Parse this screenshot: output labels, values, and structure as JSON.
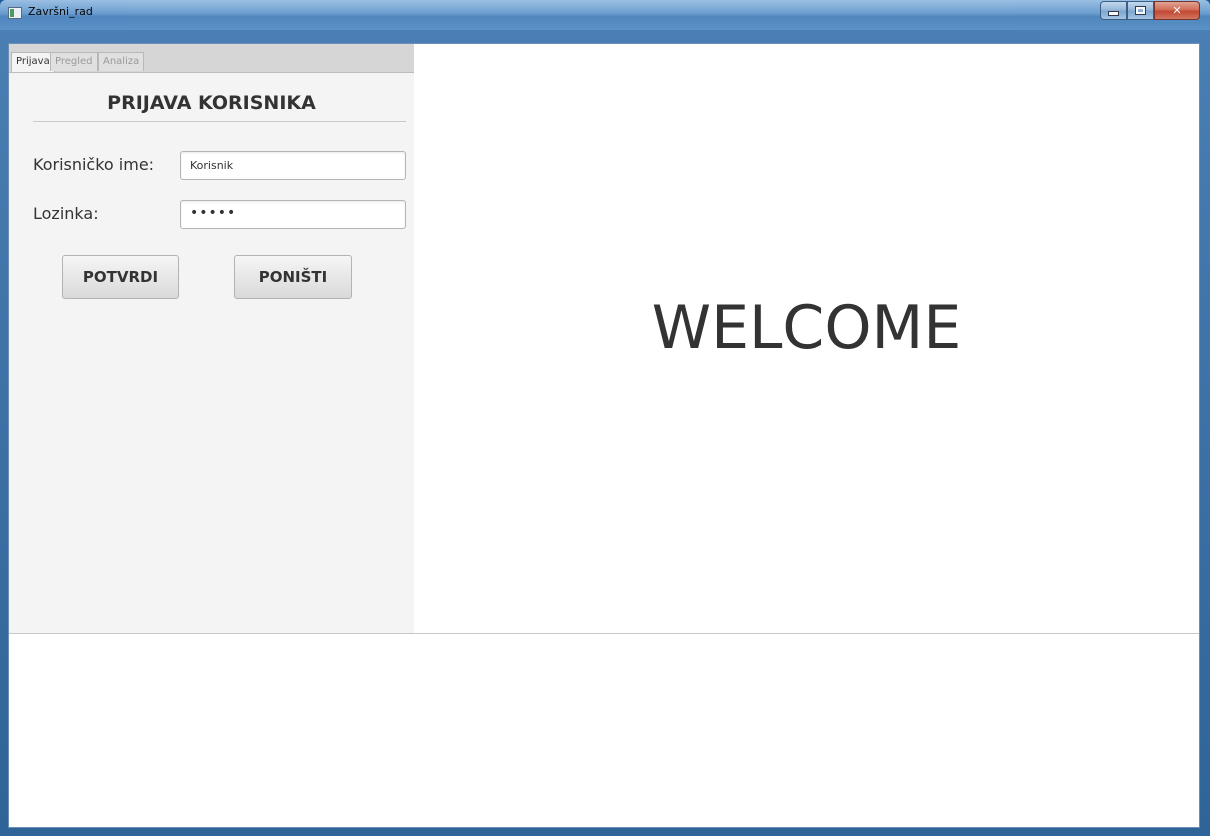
{
  "window": {
    "title": "Završni_rad"
  },
  "tabs": [
    {
      "label": "Prijava",
      "active": true
    },
    {
      "label": "Pregled",
      "active": false
    },
    {
      "label": "Analiza",
      "active": false
    }
  ],
  "login": {
    "heading": "PRIJAVA KORISNIKA",
    "username_label": "Korisničko ime:",
    "username_value": "Korisnik",
    "password_label": "Lozinka:",
    "password_value": "•••••",
    "confirm_label": "POTVRDI",
    "cancel_label": "PONIŠTI"
  },
  "main": {
    "welcome_text": "WELCOME"
  },
  "icons": {
    "app": "app-window-icon",
    "minimize": "minimize-icon",
    "maximize": "maximize-icon",
    "close": "close-icon"
  }
}
